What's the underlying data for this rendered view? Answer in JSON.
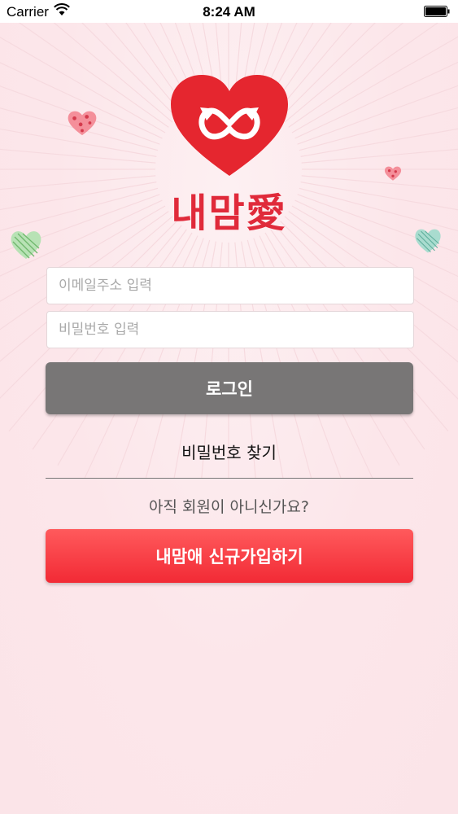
{
  "status_bar": {
    "carrier": "Carrier",
    "time": "8:24 AM",
    "wifi_icon": "wifi-icon",
    "battery_icon": "battery-icon"
  },
  "brand": {
    "name": "내맘愛",
    "logo_icon": "heart-infinity-logo",
    "color": "#e02a3a"
  },
  "login_form": {
    "email_placeholder": "이메일주소 입력",
    "email_value": "",
    "password_placeholder": "비밀번호 입력",
    "password_value": "",
    "login_label": "로그인",
    "login_color": "#787676"
  },
  "find_password_label": "비밀번호 찾기",
  "not_member_text": "아직 회원이 아니신가요?",
  "signup": {
    "label": "내맘애 신규가입하기",
    "color": "#f22a35"
  },
  "decorations": [
    "pink-heart-icon",
    "small-pink-heart-icon",
    "green-heart-icon",
    "teal-heart-icon"
  ]
}
